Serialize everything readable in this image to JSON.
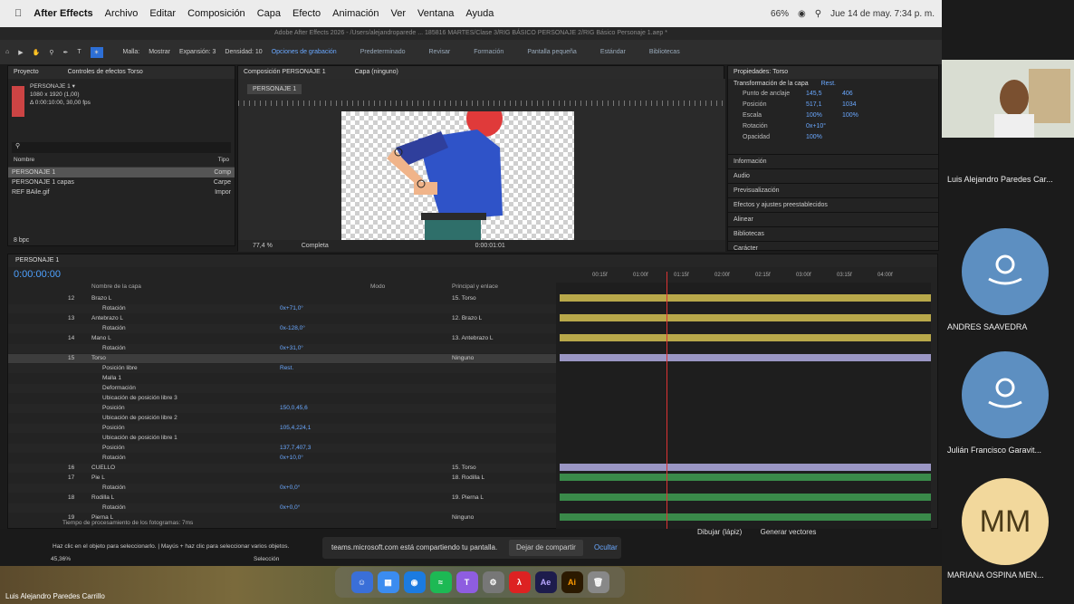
{
  "mac_menu": {
    "app": "After Effects",
    "items": [
      "Archivo",
      "Editar",
      "Composición",
      "Capa",
      "Efecto",
      "Animación",
      "Ver",
      "Ventana",
      "Ayuda"
    ],
    "battery": "66%",
    "datetime": "Jue 14 de may. 7:34 p. m."
  },
  "window_title": "Adobe After Effects 2026 - /Users/alejandroparede ... 185816 MARTES/Clase 3/RIG BÁSICO PERSONAJE 2/RIG Básico Personaje 1.aep *",
  "toolbar": {
    "malla": "Malla:",
    "mostrar": "Mostrar",
    "expansion": "Expansión: 3",
    "densidad": "Densidad: 10",
    "opciones": "Opciones de grabación",
    "workspaces": [
      "Predeterminado",
      "Revisar",
      "Formación",
      "Pantalla pequeña",
      "Estándar",
      "Bibliotecas"
    ]
  },
  "project": {
    "tab1": "Proyecto",
    "tab2": "Controles de efectos Torso",
    "comp_name": "PERSONAJE 1 ▾",
    "comp_info1": "1080 x 1920 (1,00)",
    "comp_info2": "Δ 0:00:10:00, 30,00 fps",
    "col_name": "Nombre",
    "col_type": "Tipo",
    "items": [
      {
        "name": "PERSONAJE 1",
        "type": "Comp"
      },
      {
        "name": "PERSONAJE 1 capas",
        "type": "Carpe"
      },
      {
        "name": "REF BAile.gif",
        "type": "Impor"
      }
    ],
    "bpc": "8 bpc"
  },
  "comp": {
    "tab": "Composición PERSONAJE 1",
    "layer_tab": "Capa (ninguno)",
    "badge": "PERSONAJE 1",
    "zoom": "77,4 %",
    "quality": "Completa",
    "timecode": "0:00:01:01"
  },
  "props": {
    "title": "Propiedades: Torso",
    "section": "Transformación de la capa",
    "reset": "Rest.",
    "rows": [
      {
        "label": "Punto de anclaje",
        "v1": "145,5",
        "v2": "406"
      },
      {
        "label": "Posición",
        "v1": "517,1",
        "v2": "1034"
      },
      {
        "label": "Escala",
        "v1": "100%",
        "v2": "100%"
      },
      {
        "label": "Rotación",
        "v1": "0x+10°",
        "v2": ""
      },
      {
        "label": "Opacidad",
        "v1": "100%",
        "v2": ""
      }
    ],
    "sections": [
      "Información",
      "Audio",
      "Previsualización",
      "Efectos y ajustes preestablecidos",
      "Alinear",
      "Bibliotecas",
      "Carácter"
    ]
  },
  "timeline": {
    "tab": "PERSONAJE 1",
    "timecode": "0:00:00:00",
    "col_name": "Nombre de la capa",
    "col_mode": "Modo",
    "col_parent": "Principal y enlace",
    "ruler": [
      "00:15f",
      "01:00f",
      "01:15f",
      "02:00f",
      "02:15f",
      "03:00f",
      "03:15f",
      "04:00f"
    ],
    "rows": [
      {
        "num": "12",
        "name": "Brazo L",
        "val": "",
        "parent": "15. Torso",
        "bar": "#b8a84a"
      },
      {
        "num": "",
        "name": "Rotación",
        "val": "0x+71,0°",
        "parent": "",
        "bar": ""
      },
      {
        "num": "13",
        "name": "Antebrazo L",
        "val": "",
        "parent": "12. Brazo L",
        "bar": "#b8a84a"
      },
      {
        "num": "",
        "name": "Rotación",
        "val": "0x-128,0°",
        "parent": "",
        "bar": ""
      },
      {
        "num": "14",
        "name": "Mano L",
        "val": "",
        "parent": "13. Antebrazo L",
        "bar": "#b8a84a"
      },
      {
        "num": "",
        "name": "Rotación",
        "val": "0x+31,0°",
        "parent": "",
        "bar": ""
      },
      {
        "num": "15",
        "name": "Torso",
        "val": "",
        "parent": "Ninguno",
        "bar": "#9a96c4"
      },
      {
        "num": "",
        "name": "Posición libre",
        "val": "Rest.",
        "parent": "",
        "bar": ""
      },
      {
        "num": "",
        "name": "Malla 1",
        "val": "",
        "parent": "",
        "bar": ""
      },
      {
        "num": "",
        "name": "Deformación",
        "val": "",
        "parent": "",
        "bar": ""
      },
      {
        "num": "",
        "name": "Ubicación de posición libre 3",
        "val": "",
        "parent": "",
        "bar": ""
      },
      {
        "num": "",
        "name": "Posición",
        "val": "150,0,45,6",
        "parent": "",
        "bar": ""
      },
      {
        "num": "",
        "name": "Ubicación de posición libre 2",
        "val": "",
        "parent": "",
        "bar": ""
      },
      {
        "num": "",
        "name": "Posición",
        "val": "105,4,224,1",
        "parent": "",
        "bar": ""
      },
      {
        "num": "",
        "name": "Ubicación de posición libre 1",
        "val": "",
        "parent": "",
        "bar": ""
      },
      {
        "num": "",
        "name": "Posición",
        "val": "137,7,407,3",
        "parent": "",
        "bar": ""
      },
      {
        "num": "",
        "name": "Rotación",
        "val": "0x+10,0°",
        "parent": "",
        "bar": ""
      },
      {
        "num": "16",
        "name": "CUELLO",
        "val": "",
        "parent": "15. Torso",
        "bar": "#9a96c4"
      },
      {
        "num": "17",
        "name": "Pie L",
        "val": "",
        "parent": "18. Rodilla L",
        "bar": "#3a8a4a"
      },
      {
        "num": "",
        "name": "Rotación",
        "val": "0x+0,0°",
        "parent": "",
        "bar": ""
      },
      {
        "num": "18",
        "name": "Rodilla L",
        "val": "",
        "parent": "19. Pierna L",
        "bar": "#3a8a4a"
      },
      {
        "num": "",
        "name": "Rotación",
        "val": "0x+0,0°",
        "parent": "",
        "bar": ""
      },
      {
        "num": "19",
        "name": "Pierna L",
        "val": "",
        "parent": "Ninguno",
        "bar": "#3a8a4a"
      }
    ],
    "footer": "Tiempo de procesamiento de los fotogramas: 7ms"
  },
  "teams": {
    "share_text": "teams.microsoft.com está compartiendo tu pantalla.",
    "stop_btn": "Dejar de compartir",
    "hide_btn": "Ocultar",
    "hint": "Haz clic en el objeto para seleccionarlo. | Mayús + haz clic para seleccionar varios objetos.",
    "zoom": "45,36%",
    "mode": "Selección",
    "draw": "Dibujar (lápiz)",
    "vectors": "Generar vectores",
    "presenter": "Luis Alejandro Paredes Carrillo"
  },
  "participants": [
    {
      "name": "Luis Alejandro Paredes Car...",
      "kind": "video"
    },
    {
      "name": "ANDRES SAAVEDRA",
      "kind": "avatar"
    },
    {
      "name": "Julián Francisco Garavit...",
      "kind": "avatar"
    },
    {
      "name": "MARIANA OSPINA MEN...",
      "kind": "initials",
      "initials": "MM"
    }
  ]
}
